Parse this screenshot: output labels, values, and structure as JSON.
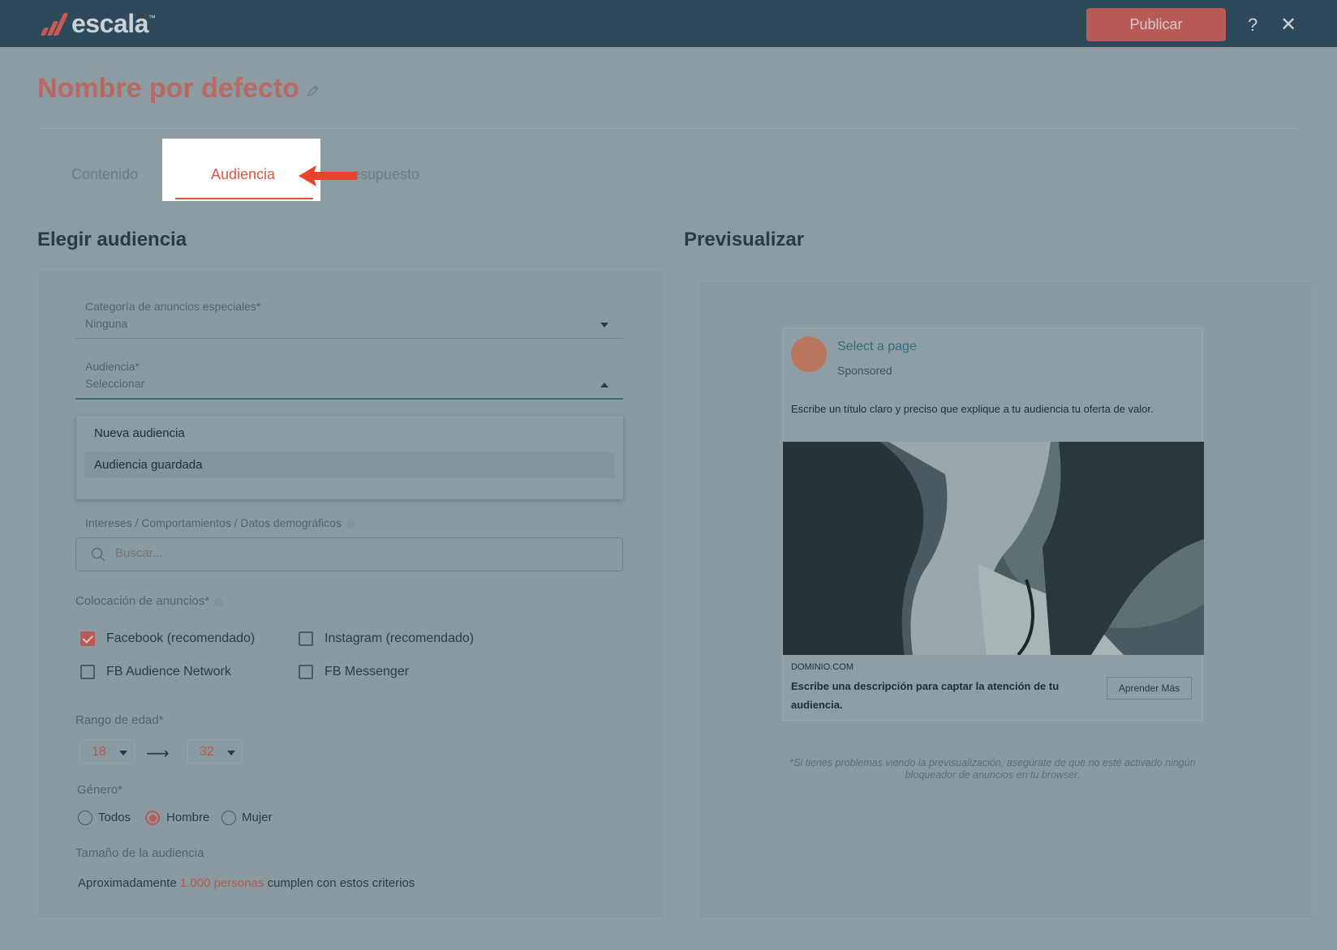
{
  "app": {
    "brand": "escala",
    "brand_tm": "™"
  },
  "topbar": {
    "publish_label": "Publicar",
    "help_glyph": "?",
    "close_glyph": "✕"
  },
  "page": {
    "title": "Nombre por defecto"
  },
  "tabs": [
    {
      "label": "Contenido",
      "active": false
    },
    {
      "label": "Audiencia",
      "active": true
    },
    {
      "label": "Presupuesto",
      "active": false,
      "visible_text": "esupuesto"
    }
  ],
  "audience": {
    "heading": "Elegir audiencia",
    "special_category": {
      "label": "Categoría de anuncios especiales*",
      "value": "Ninguna"
    },
    "audience_select": {
      "label": "Audiencia*",
      "value": "Seleccionar",
      "options": [
        "Nueva audiencia",
        "Audiencia guardada"
      ]
    },
    "interests": {
      "label": "Intereses / Comportamientos / Datos demográficos",
      "placeholder": "Buscar..."
    },
    "placements": {
      "label": "Colocación de anuncios*",
      "options": [
        {
          "label": "Facebook (recomendado)",
          "checked": true
        },
        {
          "label": "Instagram (recomendado)",
          "checked": false
        },
        {
          "label": "FB Audience Network",
          "checked": false
        },
        {
          "label": "FB Messenger",
          "checked": false
        }
      ]
    },
    "age_range": {
      "label": "Rango de edad*",
      "min": "18",
      "max": "32",
      "arrow": "⟶"
    },
    "gender": {
      "label": "Género*",
      "options": [
        {
          "label": "Todos",
          "checked": false
        },
        {
          "label": "Hombre",
          "checked": true
        },
        {
          "label": "Mujer",
          "checked": false
        }
      ]
    },
    "size": {
      "label": "Tamaño de la audiencia",
      "prefix": "Aproximadamente",
      "highlight": "1.000 personas",
      "suffix": "cumplen con estos criterios"
    }
  },
  "preview": {
    "heading": "Previsualizar",
    "page_name": "Select a page",
    "sponsored": "Sponsored",
    "ad_title": "Escribe un título claro y preciso que explique a tu audiencia tu oferta de valor.",
    "domain": "DOMINIO.COM",
    "description": "Escribe una descripción para captar la atención de tu audiencia.",
    "cta": "Aprender Más",
    "note": "*Si tienes problemas viendo la previsualización, asegúrate de que no esté activado ningún bloqueador de anuncios en tu browser."
  },
  "colors": {
    "accent": "#d9573f",
    "brand_red": "#b85a55",
    "topbar": "#2e4a5a",
    "overlay": "#8d9ca3"
  }
}
